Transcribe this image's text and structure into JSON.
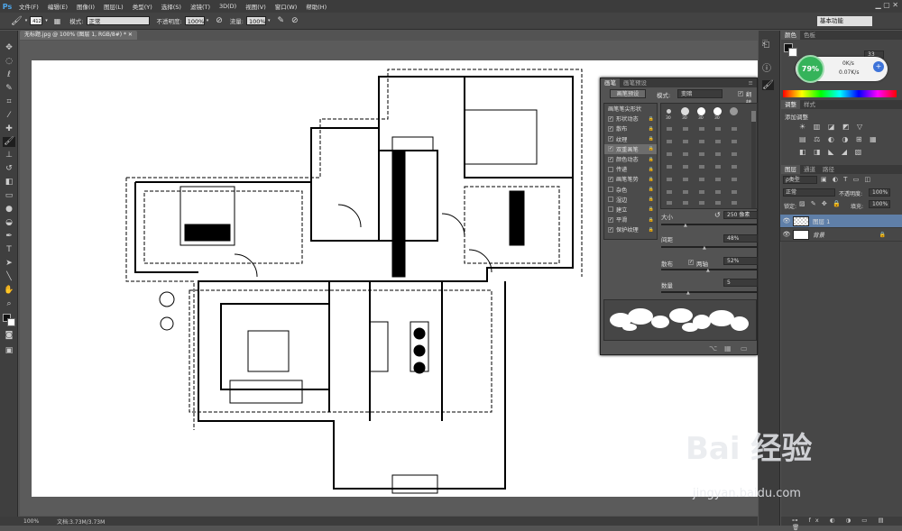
{
  "app": {
    "logo": "Ps"
  },
  "menu": [
    "文件(F)",
    "编辑(E)",
    "图像(I)",
    "图层(L)",
    "类型(Y)",
    "选择(S)",
    "滤镜(T)",
    "3D(D)",
    "视图(V)",
    "窗口(W)",
    "帮助(H)"
  ],
  "options": {
    "brush_size": "412",
    "mode_label": "模式:",
    "mode_value": "正常",
    "opacity_label": "不透明度:",
    "opacity_value": "100%",
    "flow_label": "流量:",
    "flow_value": "100%",
    "workspace": "基本功能"
  },
  "document": {
    "tab": "无标题.jpg @ 100% (图层 1, RGB/8#) *"
  },
  "status": {
    "zoom": "100%",
    "doc_size": "文档:3.73M/3.73M"
  },
  "brush_panel": {
    "tabs": [
      "画笔",
      "画笔预设"
    ],
    "preset_button": "画笔预设",
    "mode_label": "模式:",
    "mode_value": "变暗",
    "flip_label": "翻转",
    "list_header": "画笔笔尖形状",
    "items": [
      {
        "label": "形状动态",
        "checked": true
      },
      {
        "label": "散布",
        "checked": true
      },
      {
        "label": "纹理",
        "checked": true
      },
      {
        "label": "双重画笔",
        "checked": true,
        "selected": true
      },
      {
        "label": "颜色动态",
        "checked": true
      },
      {
        "label": "传递",
        "checked": false
      },
      {
        "label": "画笔笔势",
        "checked": true
      },
      {
        "label": "杂色",
        "checked": false
      },
      {
        "label": "湿边",
        "checked": false
      },
      {
        "label": "建立",
        "checked": false
      },
      {
        "label": "平滑",
        "checked": true
      },
      {
        "label": "保护纹理",
        "checked": true
      }
    ],
    "tip_sizes": [
      "30",
      "30",
      "30",
      "30"
    ],
    "size_label": "大小",
    "size_value": "250 像素",
    "spacing_label": "间距",
    "spacing_value": "48%",
    "scatter_label": "散布",
    "both_axes_label": "两轴",
    "scatter_value": "52%",
    "count_label": "数量",
    "count_value": "5",
    "spacing_fraction": 0.48,
    "scatter_fraction": 0.52,
    "count_fraction": 0.3
  },
  "color_panel": {
    "tabs": [
      "颜色",
      "色板"
    ],
    "value": "33"
  },
  "hud": {
    "percent": "79%",
    "rate1": "0K/s",
    "rate2": "0.07K/s"
  },
  "adjust_panel": {
    "tabs": [
      "调整",
      "样式"
    ],
    "title": "添加调整"
  },
  "layers_panel": {
    "tabs": [
      "图层",
      "通道",
      "路径"
    ],
    "filter": "ρ类型",
    "blend": "正常",
    "opacity_label": "不透明度:",
    "opacity_value": "100%",
    "lock_label": "锁定:",
    "fill_label": "填充:",
    "fill_value": "100%",
    "layers": [
      {
        "name": "图层 1",
        "active": true
      },
      {
        "name": "背景",
        "active": false
      }
    ]
  },
  "watermark": {
    "text": "Bai 经验",
    "url": "jingyan.baidu.com"
  },
  "colors": {
    "accent": "#4ea6ea",
    "panel": "#535353",
    "hud_green": "#35b35a"
  }
}
